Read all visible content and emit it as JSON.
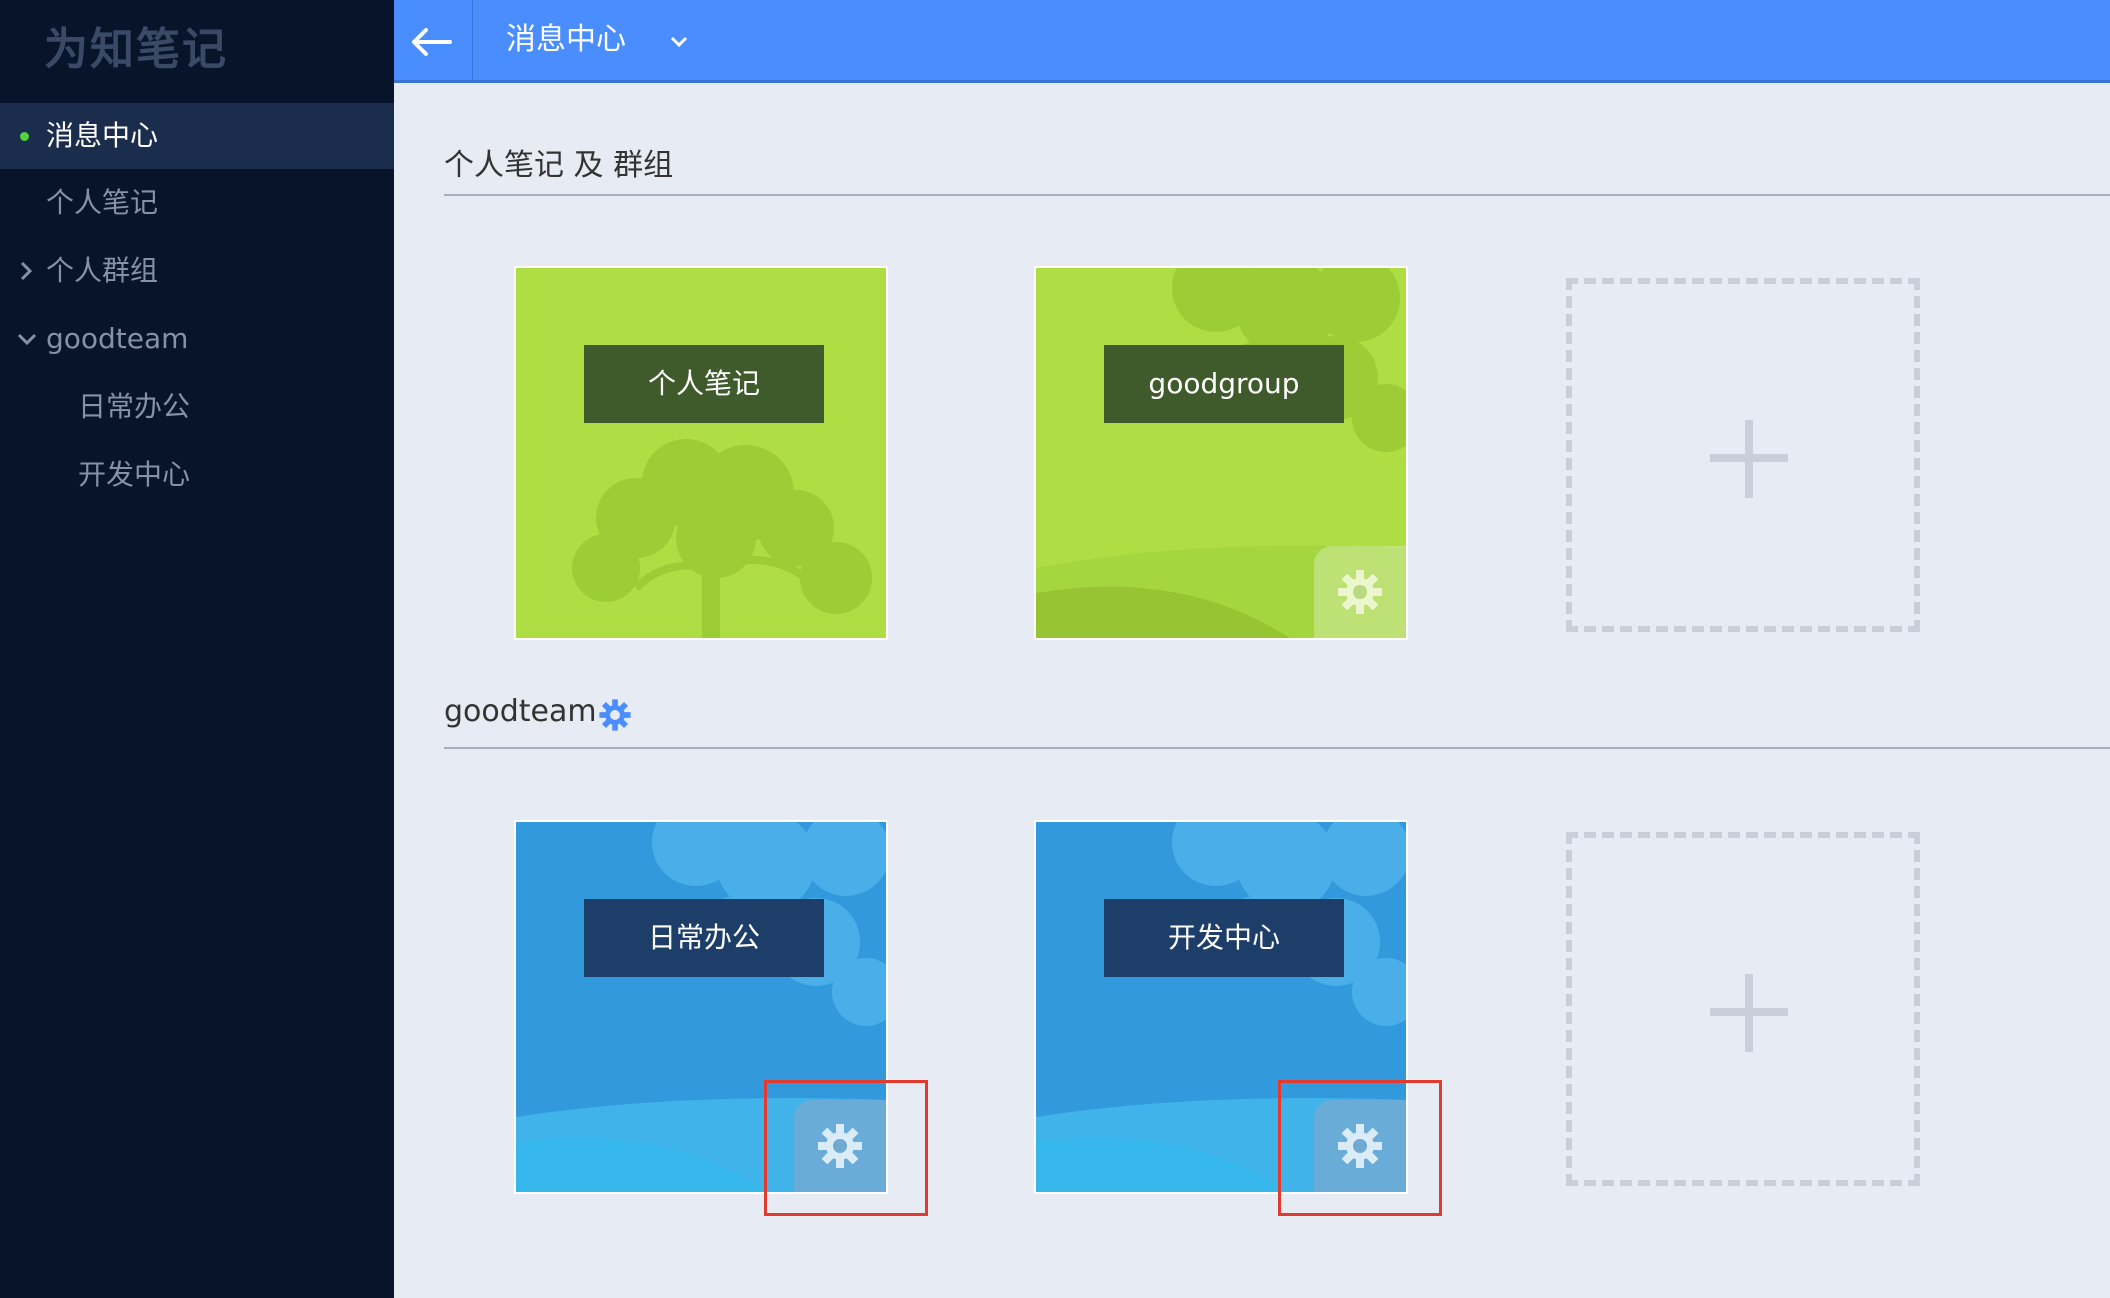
{
  "app": {
    "logo": "为知笔记"
  },
  "sidebar": {
    "items": [
      {
        "label": "消息中心",
        "active": true
      },
      {
        "label": "个人笔记"
      },
      {
        "label": "个人群组",
        "expand": "collapsed"
      },
      {
        "label": "goodteam",
        "expand": "expanded"
      },
      {
        "label": "日常办公"
      },
      {
        "label": "开发中心"
      }
    ]
  },
  "topbar": {
    "title": "消息中心"
  },
  "sections": {
    "personal": {
      "title": "个人笔记 及 群组",
      "cards": [
        {
          "name": "个人笔记",
          "theme": "green"
        },
        {
          "name": "goodgroup",
          "theme": "green"
        }
      ]
    },
    "team": {
      "title": "goodteam",
      "cards": [
        {
          "name": "日常办公",
          "theme": "blue"
        },
        {
          "name": "开发中心",
          "theme": "blue"
        }
      ]
    }
  },
  "colors": {
    "sidebar_bg": "#08142a",
    "topbar_bg": "#4a8dff",
    "page_bg": "#e7ebf4",
    "green_card": "#aede43",
    "blue_card": "#3399dd",
    "highlight": "#e23a2e",
    "active_dot": "#54d13c"
  },
  "icons": [
    "back-arrow-icon",
    "chevron-down-icon",
    "chevron-right-icon",
    "gear-icon",
    "plus-icon"
  ]
}
